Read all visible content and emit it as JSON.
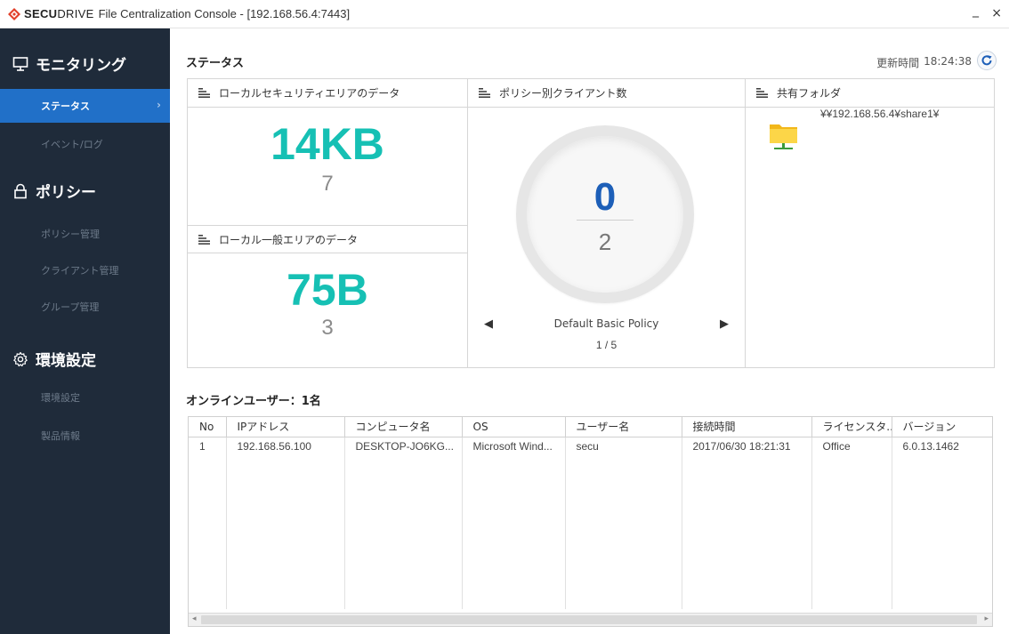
{
  "window": {
    "brand_bold": "SECU",
    "brand_light": "DRIVE",
    "title": "File Centralization Console - [192.168.56.4:7443]",
    "minimize": "_",
    "close": "×"
  },
  "sidebar": {
    "sections": [
      {
        "label": "モニタリング",
        "icon": "monitor-icon",
        "items": [
          {
            "label": "ステータス",
            "active": true
          },
          {
            "label": "イベント/ログ"
          }
        ]
      },
      {
        "label": "ポリシー",
        "icon": "lock-icon",
        "items": [
          {
            "label": "ポリシー管理"
          },
          {
            "label": "クライアント管理"
          },
          {
            "label": "グループ管理"
          }
        ]
      },
      {
        "label": "環境設定",
        "icon": "gear-icon",
        "items": [
          {
            "label": "環境設定"
          },
          {
            "label": "製品情報"
          }
        ]
      }
    ]
  },
  "main": {
    "title": "ステータス",
    "update_label": "更新時間",
    "update_time": "18:24:38"
  },
  "panels": {
    "secure": {
      "title": "ローカルセキュリティエリアのデータ",
      "size": "14KB",
      "count": "7"
    },
    "general": {
      "title": "ローカル一般エリアのデータ",
      "size": "75B",
      "count": "3"
    },
    "policy": {
      "title": "ポリシー別クライアント数",
      "online": "0",
      "total": "2",
      "name": "Default Basic Policy",
      "page": "1 / 5",
      "prev": "◀",
      "next": "▶"
    },
    "share": {
      "title": "共有フォルダ",
      "path": "¥¥192.168.56.4¥share1¥"
    }
  },
  "users": {
    "title": "オンラインユーザー：1名",
    "columns": [
      "No",
      "IPアドレス",
      "コンピュータ名",
      "OS",
      "ユーザー名",
      "接続時間",
      "ライセンスタ...",
      "バージョン"
    ],
    "rows": [
      [
        "1",
        "192.168.56.100",
        "DESKTOP-JO6KG...",
        "Microsoft Wind...",
        "secu",
        "2017/06/30 18:21:31",
        "Office",
        "6.0.13.1462"
      ]
    ]
  },
  "colors": {
    "sidebar_bg": "#1f2b3a",
    "active_bg": "#2170c8",
    "accent_teal": "#16c0b4",
    "accent_blue": "#1d5fb8",
    "logo_red": "#e2402b"
  }
}
